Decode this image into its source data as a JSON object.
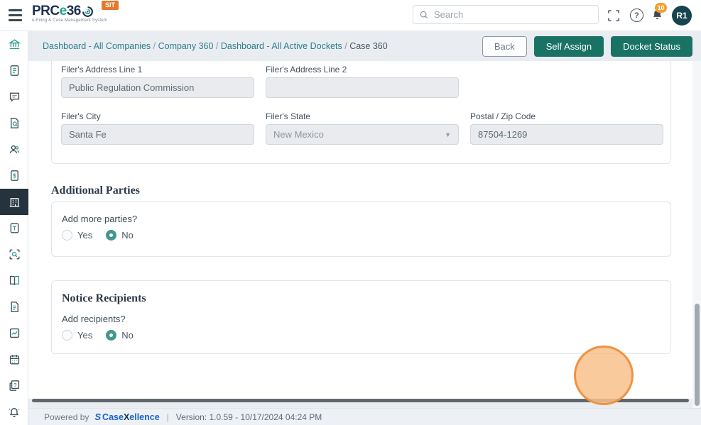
{
  "header": {
    "brand": {
      "name": "PRCe360",
      "part_dark1": "PRC",
      "part_teal": "e",
      "part_dark2": "36",
      "tagline": "e-Filing & Case Management System",
      "env_badge": "SIT"
    },
    "search": {
      "placeholder": "Search"
    },
    "notifications": {
      "count": "10"
    },
    "avatar": "R1"
  },
  "breadcrumb": {
    "separator": " / ",
    "items": [
      {
        "label": "Dashboard - All Companies"
      },
      {
        "label": "Company 360"
      },
      {
        "label": "Dashboard - All Active Dockets"
      },
      {
        "label": "Case 360"
      }
    ]
  },
  "toolbar": {
    "back_label": "Back",
    "self_assign_label": "Self Assign",
    "docket_status_label": "Docket Status"
  },
  "form": {
    "address": {
      "fields": [
        {
          "label": "Filer's Address Line 1",
          "value": "Public Regulation Commission"
        },
        {
          "label": "Filer's Address Line 2",
          "value": ""
        },
        {
          "label": "Filer's City",
          "value": "Santa Fe"
        },
        {
          "label": "Filer's State",
          "value": "New Mexico"
        },
        {
          "label": "Postal / Zip Code",
          "value": "87504-1269"
        }
      ]
    },
    "additional_parties": {
      "title": "Additional Parties",
      "question": "Add more parties?",
      "options": [
        {
          "label": "Yes",
          "selected": false
        },
        {
          "label": "No",
          "selected": true
        }
      ]
    },
    "notice_recipients": {
      "title": "Notice Recipients",
      "question": "Add recipients?",
      "options": [
        {
          "label": "Yes",
          "selected": false
        },
        {
          "label": "No",
          "selected": true
        }
      ]
    }
  },
  "sidebar": {
    "items": [
      {
        "icon": "bank-icon",
        "active": false
      },
      {
        "icon": "document-icon",
        "active": false
      },
      {
        "icon": "chat-icon",
        "active": false
      },
      {
        "icon": "file-search-icon",
        "active": false
      },
      {
        "icon": "users-icon",
        "active": false
      },
      {
        "icon": "billing-icon",
        "active": false
      },
      {
        "icon": "building-icon",
        "active": true
      },
      {
        "icon": "task-file-icon",
        "active": false
      },
      {
        "icon": "scan-search-icon",
        "active": false
      },
      {
        "icon": "ledger-icon",
        "active": false
      },
      {
        "icon": "report-icon",
        "active": false
      },
      {
        "icon": "analytics-icon",
        "active": false
      },
      {
        "icon": "calendar-icon",
        "active": false
      },
      {
        "icon": "help-doc-icon",
        "active": false
      }
    ],
    "bottom_icon": "bell-icon"
  },
  "footer": {
    "powered_by": "Powered by",
    "brand_part1": "Case",
    "brand_part2": "X",
    "brand_part3": "ellence",
    "separator": "|",
    "version": "Version: 1.0.59 - 10/17/2024 04:24 PM"
  },
  "colors": {
    "teal_button": "#1a7265",
    "breadcrumb_link": "#2c7e8c",
    "env_badge_orange": "#e8772e",
    "notification_orange": "#f59e2e",
    "radio_teal": "#40988c",
    "brand_blue": "#1863d0",
    "avatar_bg": "#16454f",
    "active_sidebar_bg": "#24333d"
  }
}
